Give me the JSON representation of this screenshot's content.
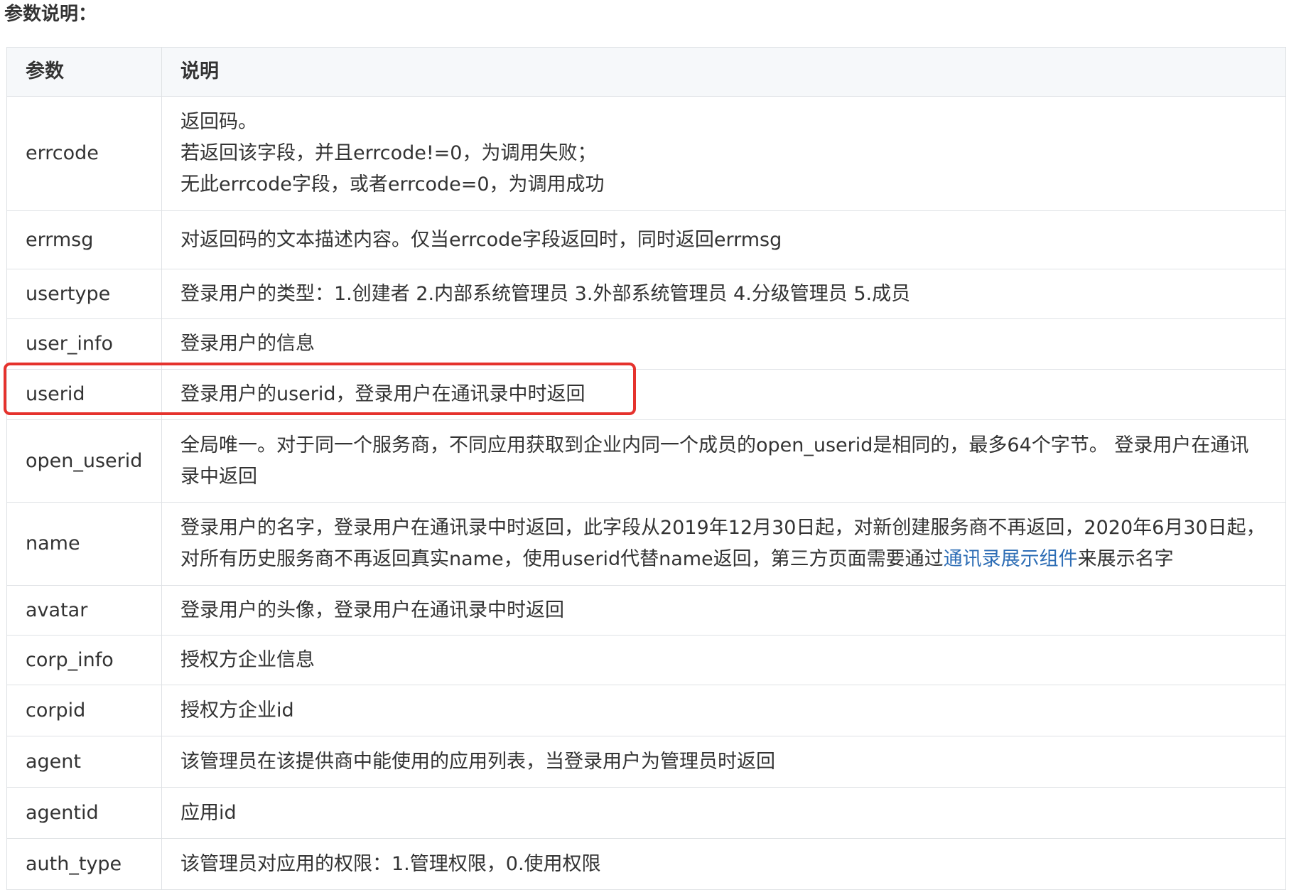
{
  "section_title": "参数说明：",
  "table": {
    "headers": [
      "参数",
      "说明"
    ],
    "rows": [
      {
        "param": "errcode",
        "desc_lines": [
          "返回码。",
          "若返回该字段，并且errcode!=0，为调用失败；",
          "无此errcode字段，或者errcode=0，为调用成功"
        ]
      },
      {
        "param": "errmsg",
        "desc_lines": [
          "对返回码的文本描述内容。仅当errcode字段返回时，同时返回errmsg"
        ]
      },
      {
        "param": "usertype",
        "desc_lines": [
          "登录用户的类型：1.创建者 2.内部系统管理员 3.外部系统管理员 4.分级管理员 5.成员"
        ]
      },
      {
        "param": "user_info",
        "desc_lines": [
          "登录用户的信息"
        ]
      },
      {
        "param": "userid",
        "desc_lines": [
          "登录用户的userid，登录用户在通讯录中时返回"
        ]
      },
      {
        "param": "open_userid",
        "desc_lines": [
          "全局唯一。对于同一个服务商，不同应用获取到企业内同一个成员的open_userid是相同的，最多64个字节。 登录用户在通讯录中返回"
        ]
      },
      {
        "param": "name",
        "desc_before_link": "登录用户的名字，登录用户在通讯录中时返回，此字段从2019年12月30日起，对新创建服务商不再返回，2020年6月30日起，对所有历史服务商不再返回真实name，使用userid代替name返回，第三方页面需要通过",
        "link_text": "通讯录展示组件",
        "desc_after_link": "来展示名字"
      },
      {
        "param": "avatar",
        "desc_lines": [
          "登录用户的头像，登录用户在通讯录中时返回"
        ]
      },
      {
        "param": "corp_info",
        "desc_lines": [
          "授权方企业信息"
        ]
      },
      {
        "param": "corpid",
        "desc_lines": [
          "授权方企业id"
        ]
      },
      {
        "param": "agent",
        "desc_lines": [
          "该管理员在该提供商中能使用的应用列表，当登录用户为管理员时返回"
        ]
      },
      {
        "param": "agentid",
        "desc_lines": [
          "应用id"
        ]
      },
      {
        "param": "auth_type",
        "desc_lines": [
          "该管理员对应用的权限：1.管理权限，0.使用权限"
        ]
      }
    ]
  },
  "highlight": {
    "row": "userid",
    "color": "#e5322d"
  },
  "colors": {
    "link": "#2d6db5",
    "header_bg": "#f6f8fa",
    "border": "#dfe2e5",
    "text": "#333333"
  }
}
